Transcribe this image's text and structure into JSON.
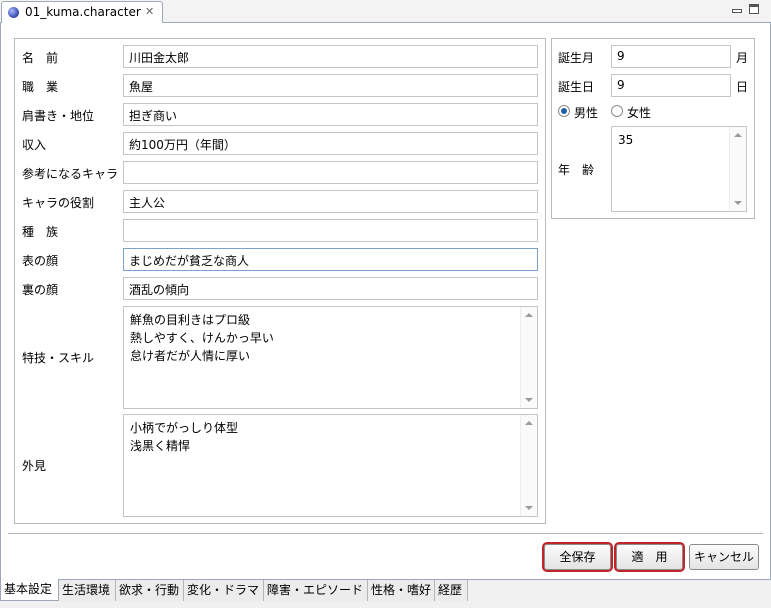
{
  "editor_tab": {
    "title": "01_kuma.character",
    "close_glyph": "✕"
  },
  "labels": {
    "name": "名　前",
    "occupation": "職　業",
    "title_position": "肩書き・地位",
    "income": "収入",
    "reference_character": "参考になるキャラ",
    "character_role": "キャラの役割",
    "race": "種　族",
    "public_face": "表の顔",
    "hidden_face": "裏の顔",
    "skills": "特技・スキル",
    "appearance": "外見",
    "birth_month": "誕生月",
    "birth_day": "誕生日",
    "age": "年　齢",
    "month_unit": "月",
    "day_unit": "日"
  },
  "fields": {
    "name": "川田金太郎",
    "occupation": "魚屋",
    "title_position": "担ぎ商い",
    "income": "約100万円（年間）",
    "reference_character": "",
    "character_role": "主人公",
    "race": "",
    "public_face": "まじめだが貧乏な商人",
    "hidden_face": "酒乱の傾向",
    "skills_lines": [
      "鮮魚の目利きはプロ級",
      "熱しやすく、けんかっ早い",
      "怠け者だが人情に厚い"
    ],
    "appearance_lines": [
      "小柄でがっしり体型",
      "浅黒く精悍"
    ],
    "birth_month": "9",
    "birth_day": "9",
    "age": "35"
  },
  "gender": {
    "male": "男性",
    "female": "女性",
    "selected": "male"
  },
  "buttons": {
    "save_all": "全保存",
    "apply": "適　用",
    "cancel": "キャンセル"
  },
  "bottom_tabs": [
    "基本設定",
    "生活環境",
    "欲求・行動",
    "変化・ドラマ",
    "障害・エピソード",
    "性格・嗜好",
    "経歴"
  ],
  "colors": {
    "focus_outline": "#c0252b",
    "radio_dot": "#1f5fa8"
  }
}
